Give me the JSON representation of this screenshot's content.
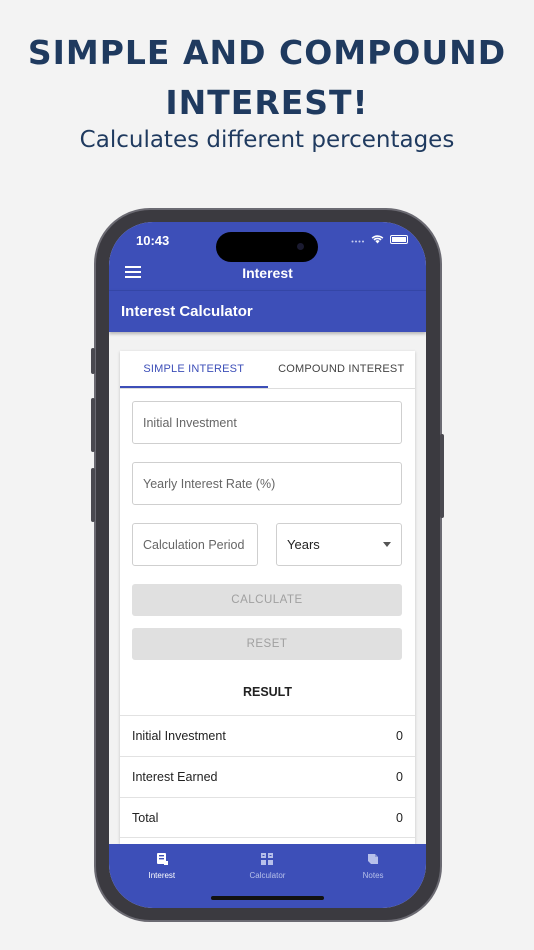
{
  "promo": {
    "headline_line1": "SIMPLE AND COMPOUND",
    "headline_line2": "INTEREST!",
    "subtitle": "Calculates different percentages"
  },
  "status_bar": {
    "time": "10:43"
  },
  "app_bar": {
    "title": "Interest"
  },
  "section": {
    "title": "Interest Calculator"
  },
  "tabs": [
    {
      "label": "SIMPLE INTEREST",
      "active": true
    },
    {
      "label": "COMPOUND INTEREST",
      "active": false
    }
  ],
  "form": {
    "initial_investment_placeholder": "Initial Investment",
    "interest_rate_placeholder": "Yearly Interest Rate (%)",
    "period_placeholder": "Calculation Period",
    "period_unit": "Years",
    "calculate_label": "CALCULATE",
    "reset_label": "RESET"
  },
  "result": {
    "title": "RESULT",
    "rows": [
      {
        "label": "Initial Investment",
        "value": "0"
      },
      {
        "label": "Interest Earned",
        "value": "0"
      },
      {
        "label": "Total",
        "value": "0"
      }
    ]
  },
  "bottom_nav": [
    {
      "label": "Interest",
      "icon": "interest-icon",
      "active": true
    },
    {
      "label": "Calculator",
      "icon": "calculator-icon",
      "active": false
    },
    {
      "label": "Notes",
      "icon": "notes-icon",
      "active": false
    }
  ],
  "colors": {
    "primary": "#3d4fb8",
    "headline": "#1f3a5f",
    "background": "#f3f3f3"
  }
}
